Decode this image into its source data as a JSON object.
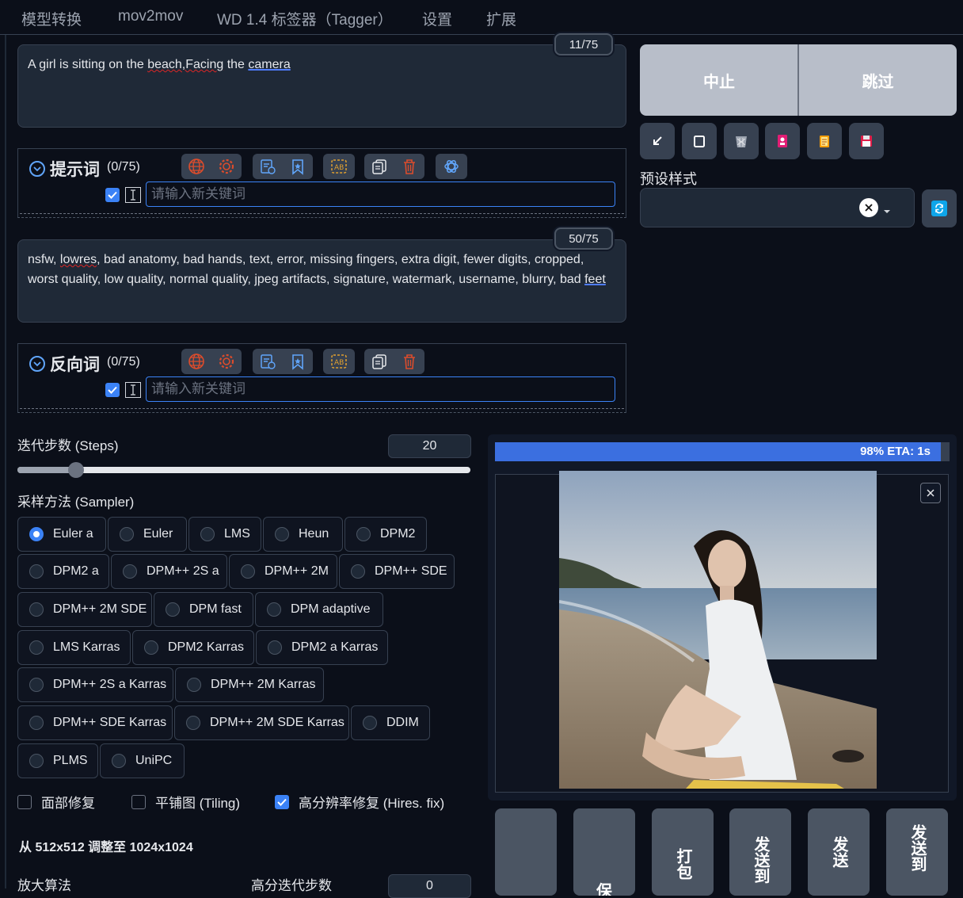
{
  "tabs": [
    "模型转换",
    "mov2mov",
    "WD 1.4 标签器（Tagger）",
    "设置",
    "扩展"
  ],
  "prompt": {
    "counter": "11/75",
    "text_parts": [
      "A girl is sitting on the ",
      "beach,Facing",
      " the ",
      "camera"
    ]
  },
  "prompt_panel": {
    "title": "提示词",
    "count": "(0/75)",
    "placeholder": "请输入新关键词"
  },
  "negative": {
    "counter": "50/75",
    "text_parts": [
      "nsfw, ",
      "lowres",
      ", bad anatomy, bad hands, text, error, missing fingers, extra digit, fewer digits, cropped, worst quality, low quality, normal quality, jpeg artifacts, signature, watermark, username, blurry, bad ",
      "feet"
    ]
  },
  "negative_panel": {
    "title": "反向词",
    "count": "(0/75)",
    "placeholder": "请输入新关键词"
  },
  "actions": {
    "interrupt": "中止",
    "skip": "跳过",
    "styles_label": "预设样式"
  },
  "steps": {
    "label": "迭代步数 (Steps)",
    "value": "20",
    "fraction": 0.13
  },
  "sampler": {
    "label": "采样方法 (Sampler)",
    "selected": "Euler a",
    "options": [
      "Euler a",
      "Euler",
      "LMS",
      "Heun",
      "DPM2",
      "DPM2 a",
      "DPM++ 2S a",
      "DPM++ 2M",
      "DPM++ SDE",
      "DPM++ 2M SDE",
      "DPM fast",
      "DPM adaptive",
      "LMS Karras",
      "DPM2 Karras",
      "DPM2 a Karras",
      "DPM++ 2S a Karras",
      "DPM++ 2M Karras",
      "DPM++ SDE Karras",
      "DPM++ 2M SDE Karras",
      "DDIM",
      "PLMS",
      "UniPC"
    ]
  },
  "checkboxes": [
    {
      "label": "面部修复",
      "checked": false
    },
    {
      "label": "平铺图 (Tiling)",
      "checked": false
    },
    {
      "label": "高分辨率修复 (Hires. fix)",
      "checked": true
    }
  ],
  "hires": {
    "resize_text": "从 512x512 调整至 1024x1024",
    "upscaler_label": "放大算法",
    "steps_label": "高分迭代步数",
    "steps_value": "0"
  },
  "progress": {
    "text": "98% ETA: 1s",
    "fraction": 0.98
  },
  "send_buttons": [
    {
      "label": ""
    },
    {
      "label": "保"
    },
    {
      "label": "打包"
    },
    {
      "label": "发送到"
    },
    {
      "label": "发送"
    },
    {
      "label": "发送到"
    }
  ],
  "colors": {
    "accent": "#3b82f6",
    "background": "#0b0f19",
    "panel": "#1f2937",
    "progress": "#3b6fe0",
    "danger_icon": "#dc4c2c"
  }
}
